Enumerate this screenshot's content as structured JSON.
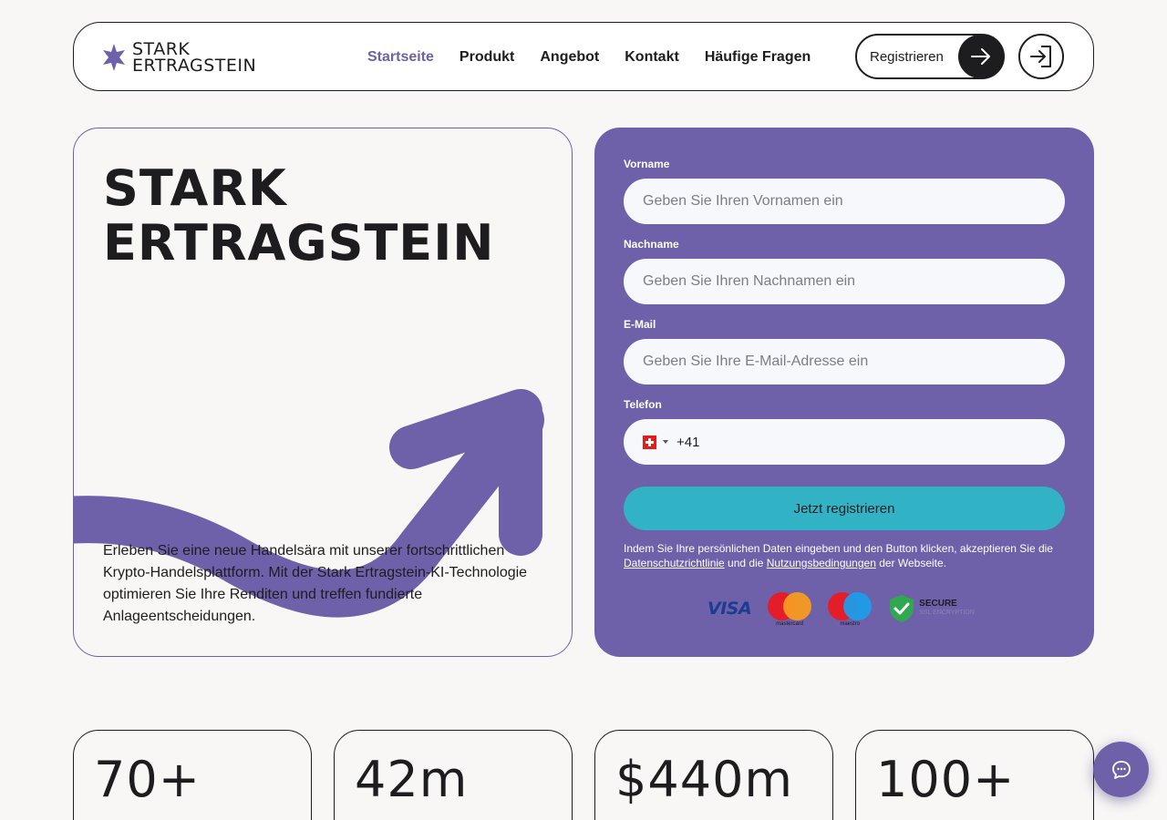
{
  "brand": {
    "line1": "STARK",
    "line2": "ERTRAGSTEIN",
    "accent": "#6e61a9"
  },
  "nav": {
    "items": [
      {
        "label": "Startseite",
        "active": true
      },
      {
        "label": "Produkt",
        "active": false
      },
      {
        "label": "Angebot",
        "active": false
      },
      {
        "label": "Kontakt",
        "active": false
      },
      {
        "label": "Häufige Fragen",
        "active": false
      }
    ],
    "register_label": "Registrieren",
    "register_icon": "arrow-right-icon",
    "login_icon": "login-icon"
  },
  "hero": {
    "title_line1": "STARK",
    "title_line2": "ERTRAGSTEIN",
    "text": "Erleben Sie eine neue Handelsära mit unserer fortschrittlichen Krypto-Handelsplattform. Mit der Stark Ertragstein-KI-Technologie optimieren Sie Ihre Renditen und treffen fundierte Anlageentscheidungen."
  },
  "form": {
    "first_name_label": "Vorname",
    "first_name_placeholder": "Geben Sie Ihren Vornamen ein",
    "last_name_label": "Nachname",
    "last_name_placeholder": "Geben Sie Ihren Nachnamen ein",
    "email_label": "E-Mail",
    "email_placeholder": "Geben Sie Ihre E-Mail-Adresse ein",
    "phone_label": "Telefon",
    "phone_dial_code": "+41",
    "phone_country_icon": "swiss-flag-icon",
    "submit_label": "Jetzt registrieren",
    "consent_before": "Indem Sie Ihre persönlichen Daten eingeben und den Button klicken, akzeptieren Sie die ",
    "privacy_link": "Datenschutzrichtlinie",
    "consent_middle": " und die ",
    "terms_link": "Nutzungsbedingungen",
    "consent_after": " der Webseite.",
    "payment": {
      "visa": "VISA",
      "mastercard": "mastercard",
      "maestro": "maestro",
      "secure_title": "SECURE",
      "secure_sub": "SSL ENCRYPTION"
    },
    "submit_color": "#31b3c5"
  },
  "stats": [
    {
      "value": "70+"
    },
    {
      "value": "42m"
    },
    {
      "value": "$440m"
    },
    {
      "value": "100+"
    }
  ],
  "chat": {
    "icon": "chat-bubble-icon"
  }
}
